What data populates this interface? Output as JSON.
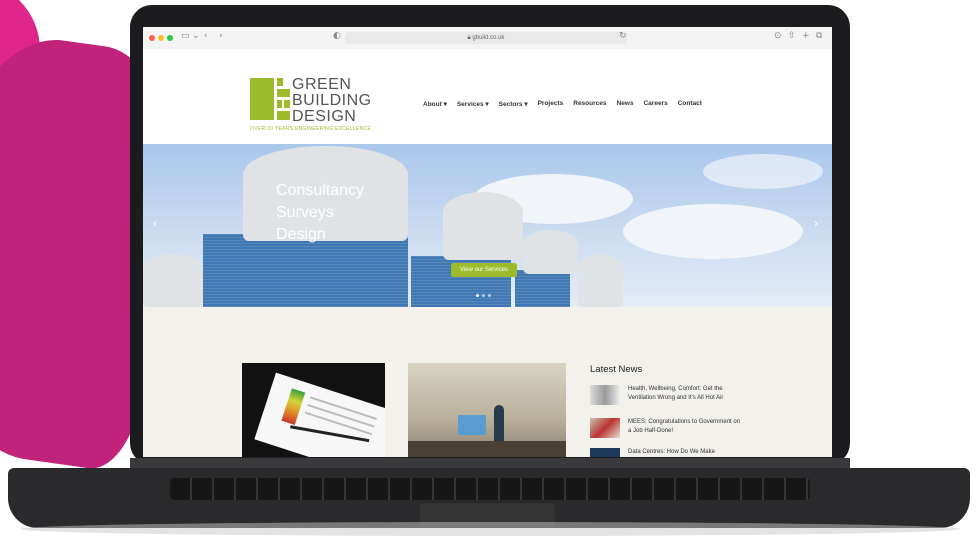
{
  "browser": {
    "url": "gbuild.co.uk"
  },
  "site": {
    "logo": {
      "line1": "GREEN",
      "line2": "BUILDING",
      "line3": "DESIGN",
      "tagline": "OVER 20 YEARS ENGINEERING EXCELLENCE",
      "brand_color": "#9dbb2c"
    },
    "nav": [
      {
        "label": "About ▾"
      },
      {
        "label": "Services ▾"
      },
      {
        "label": "Sectors ▾"
      },
      {
        "label": "Projects"
      },
      {
        "label": "Resources"
      },
      {
        "label": "News"
      },
      {
        "label": "Careers"
      },
      {
        "label": "Contact"
      }
    ],
    "hero": {
      "line1": "Consultancy",
      "line2": "Surveys",
      "line3": "Design",
      "button": "View our Services"
    },
    "latest_news": {
      "title": "Latest News",
      "items": [
        {
          "title": "Health, Wellbeing, Comfort: Get the Ventilation Wrong and It's All Hot Air"
        },
        {
          "title": "MEES: Congratulations to Government on a Job Half-Done!"
        },
        {
          "title": "Data Centres: How Do We Make"
        }
      ]
    }
  },
  "colors": {
    "accent_magenta": "#c2237a",
    "hero_button": "#9dbb2c"
  }
}
